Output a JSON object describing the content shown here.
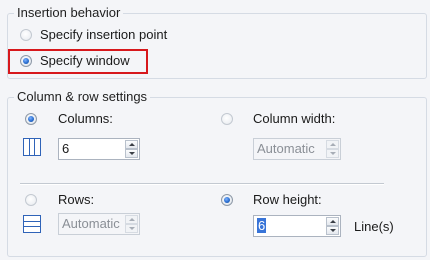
{
  "insertion_behavior": {
    "group_label": "Insertion behavior",
    "specify_insertion_point_label": "Specify insertion point",
    "specify_window_label": "Specify window",
    "selected_option": "Specify window"
  },
  "column_row_settings": {
    "group_label": "Column & row settings",
    "columns_label": "Columns:",
    "columns_value": "6",
    "column_width_label": "Column width:",
    "column_width_value": "Automatic",
    "rows_label": "Rows:",
    "rows_value": "Automatic",
    "row_height_label": "Row height:",
    "row_height_value": "6",
    "row_height_unit": "Line(s)"
  },
  "colors": {
    "highlight_border": "#d7181c",
    "selection": "#3874d8",
    "icon_blue": "#2f63b8"
  }
}
